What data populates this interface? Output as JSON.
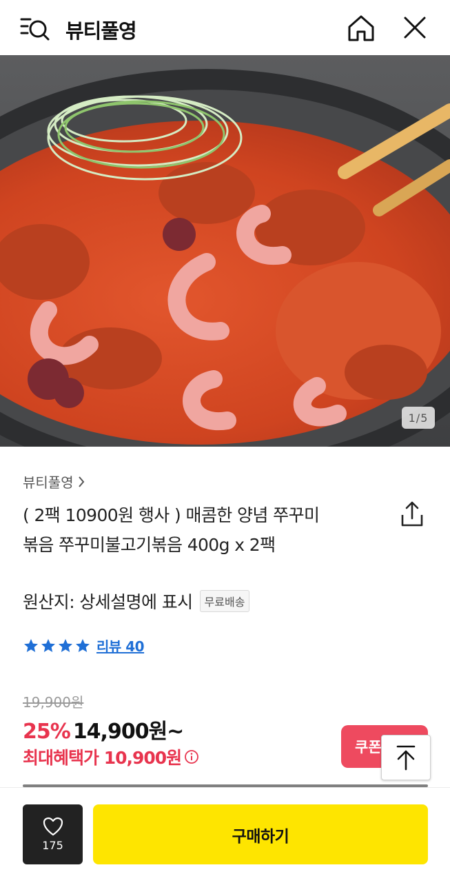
{
  "header": {
    "title": "뷰티풀영",
    "icons": {
      "search": "search-list-icon",
      "home": "home-icon",
      "close": "close-icon"
    }
  },
  "gallery": {
    "indicator": "1/5",
    "current": 1,
    "total": 5
  },
  "product": {
    "brand": "뷰티풀영",
    "title": "( 2팩 10900원 행사 ) 매콤한 양념 쭈꾸미볶음 쭈꾸미불고기볶음 400g x 2팩",
    "origin": "원산지: 상세설명에 표시",
    "shipping_badge": "무료배송",
    "rating": {
      "stars": 4,
      "review_label": "리뷰 40"
    },
    "original_price": "19,900원",
    "discount": "25%",
    "price": "14,900원~",
    "max_benefit": "최대혜택가 10,900원"
  },
  "buttons": {
    "coupon": "쿠폰",
    "like_count": "175",
    "buy": "구매하기"
  },
  "colors": {
    "accent_red": "#e8344e",
    "buy_yellow": "#fee500",
    "link_blue": "#1f6fd6"
  }
}
